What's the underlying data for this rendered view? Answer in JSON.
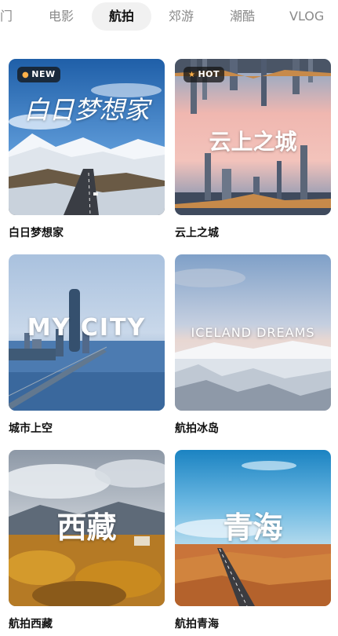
{
  "tabs": [
    {
      "label": "门"
    },
    {
      "label": "电影"
    },
    {
      "label": "航拍"
    },
    {
      "label": "郊游"
    },
    {
      "label": "潮酷"
    },
    {
      "label": "VLOG"
    }
  ],
  "active_tab": "航拍",
  "cards": [
    {
      "caption": "白日梦想家",
      "badge": "NEW",
      "badge_icon": "●",
      "overlay_title": "白日梦想家"
    },
    {
      "caption": "云上之城",
      "badge": "HOT",
      "badge_icon": "★",
      "overlay_title": "云上之城"
    },
    {
      "caption": "城市上空",
      "overlay_title": "MY CITY"
    },
    {
      "caption": "航拍冰岛",
      "overlay_title": "ICELAND DREAMS"
    },
    {
      "caption": "航拍西藏",
      "overlay_title": "西藏"
    },
    {
      "caption": "航拍青海",
      "overlay_title": "青海"
    }
  ]
}
